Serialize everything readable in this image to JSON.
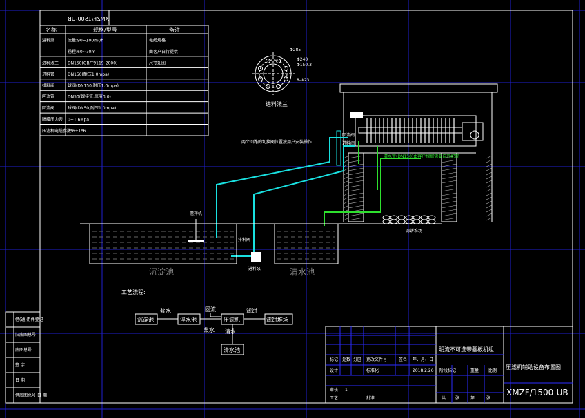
{
  "title_block_top": "XMZF/1500-UB",
  "spec_table": {
    "headers": [
      "名称",
      "规格/型号",
      "备注"
    ],
    "rows": [
      [
        "进料泵",
        "流量:90~100m³/h",
        "电缆规格"
      ],
      [
        "",
        "扬程:60~70m",
        "由客户自行提供"
      ],
      [
        "进料法兰",
        "DN150(GB/T9119-2000)",
        "尺寸如图"
      ],
      [
        "进料管",
        "DN150(耐压1.0mpa)",
        ""
      ],
      [
        "排料阀",
        "球阀(DN150,耐压1.0mpa)",
        ""
      ],
      [
        "回流管",
        "DN50(焊接管,厚度3.0)",
        ""
      ],
      [
        "回流阀",
        "球阀(DN50,耐压1.0mpa)",
        ""
      ],
      [
        "隔膜压力表",
        "0~1.6Mpa",
        ""
      ],
      [
        "压滤机电缆参数",
        "3*6+1*6",
        ""
      ]
    ]
  },
  "flange": {
    "label": "进料法兰",
    "dims": [
      "Φ285",
      "Φ240",
      "Φ150.3",
      "8-Φ23"
    ]
  },
  "plant_labels": {
    "note": "两个回路的切换阀位置按用户安装操作",
    "tank1": "沉淀池",
    "tank2": "清水池",
    "stirrer": "搅拌机",
    "pump": "进料泵",
    "valve": "排料阀",
    "cake": "滤饼堆场",
    "return_pipe": "回流管",
    "feed_pipe": "进料管",
    "drain_note": "清水管(DN150)由客户根据需要自行配置",
    "valve_a": "回流阀",
    "valve_b": "进料阀"
  },
  "process": {
    "title": "工艺流程:",
    "nodes": [
      "沉淀池",
      "浮水池",
      "压滤机",
      "滤饼堆场",
      "清水池"
    ],
    "edges": [
      "浆水",
      "回流",
      "浆水",
      "滤饼",
      "清水"
    ]
  },
  "left_strip": [
    "借(通)用件登记",
    "旧底图总号",
    "底图总号",
    "签  字",
    "日  期",
    "借底图总号  日 期"
  ],
  "title_block": {
    "model_name": "明流不可洗带翻板机组",
    "drawing_title": "压滤机辅助设备布置图",
    "drawing_no": "XMZF/1500-UB",
    "labels": [
      "标记",
      "处数",
      "分区",
      "更改文件号",
      "签名",
      "年、月、日",
      "设计",
      "标准化",
      "审核",
      "工艺",
      "批准",
      "阶段标记",
      "重量",
      "比例",
      "共",
      "张",
      "第",
      "张"
    ],
    "date": "2018.2.26",
    "scale": "1"
  }
}
